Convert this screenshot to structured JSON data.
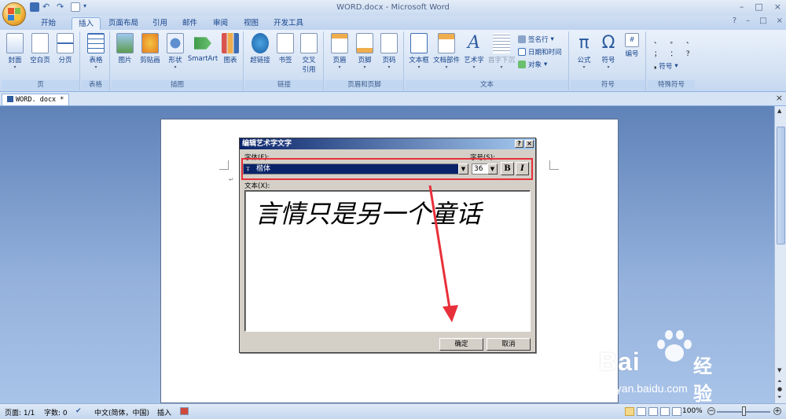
{
  "window": {
    "title": "WORD.docx - Microsoft Word",
    "controls": [
      "–",
      "□",
      "×"
    ],
    "help_icons": [
      "?",
      "–",
      "□",
      "×"
    ]
  },
  "quick_access": {
    "icons": [
      "save-icon",
      "undo-icon",
      "redo-icon",
      "print-preview-icon",
      "customize-icon"
    ]
  },
  "tabs": [
    "开始",
    "插入",
    "页面布局",
    "引用",
    "邮件",
    "审阅",
    "视图",
    "开发工具"
  ],
  "active_tab": "插入",
  "ribbon": {
    "groups": [
      {
        "label": "页",
        "buttons": [
          "封面",
          "空白页",
          "分页"
        ]
      },
      {
        "label": "表格",
        "buttons": [
          "表格"
        ]
      },
      {
        "label": "插图",
        "buttons": [
          "图片",
          "剪贴画",
          "形状",
          "SmartArt",
          "图表"
        ]
      },
      {
        "label": "链接",
        "buttons": [
          "超链接",
          "书签",
          "交叉",
          "引用"
        ]
      },
      {
        "label": "页眉和页脚",
        "buttons": [
          "页眉",
          "页脚",
          "页码"
        ]
      },
      {
        "label": "文本",
        "buttons": [
          "文本框",
          "文档部件",
          "艺术字",
          "首字下沉"
        ],
        "small": [
          "签名行",
          "日期和时间",
          "对象"
        ]
      },
      {
        "label": "符号",
        "buttons": [
          "公式",
          "符号",
          "编号"
        ]
      },
      {
        "label": "特殊符号",
        "symbols": [
          "、",
          "。",
          "、",
          "；",
          "：",
          "？"
        ],
        "small": [
          "符号"
        ]
      }
    ]
  },
  "doc_tab": {
    "label": "WORD. docx *",
    "close": "×"
  },
  "dialog": {
    "title": "编辑艺术字文字",
    "help_button": "?",
    "close_button": "×",
    "font_label": "字体(F):",
    "font_value": "楷体",
    "size_label": "字号(S):",
    "size_value": "36",
    "bold_label": "B",
    "italic_label": "I",
    "text_label": "文本(X):",
    "text_value": "言情只是另一个童话",
    "ok_label": "确定",
    "cancel_label": "取消"
  },
  "statusbar": {
    "page": "页面: 1/1",
    "words": "字数: 0",
    "language": "中文(简体，中国)",
    "mode": "插入",
    "zoom": "100%",
    "zoom_minus": "−",
    "zoom_plus": "+"
  },
  "watermark": {
    "brand": "Bai",
    "brand_cn": "经验",
    "url": "jingyan.baidu.com"
  },
  "colors": {
    "accent": "#15428b",
    "dialog_title": "#0a246a",
    "highlight": "#e8303a"
  }
}
